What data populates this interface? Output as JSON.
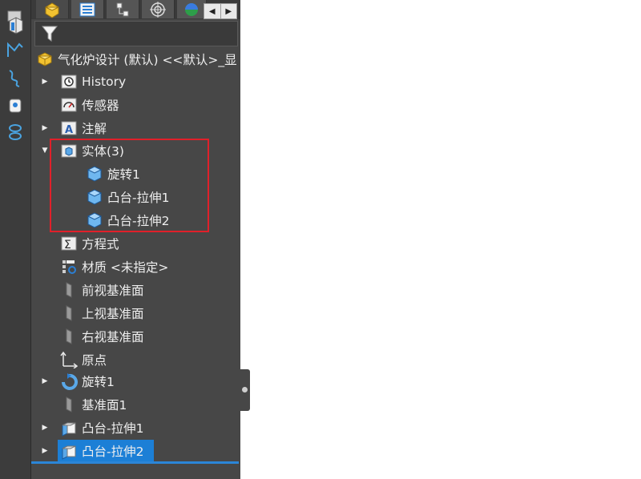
{
  "feature_tree": {
    "root_label": "气化炉设计 (默认) <<默认>_显",
    "items": [
      {
        "label": "History"
      },
      {
        "label": "传感器"
      },
      {
        "label": "注解"
      },
      {
        "label": "实体(3)"
      },
      {
        "label": "旋转1"
      },
      {
        "label": "凸台-拉伸1"
      },
      {
        "label": "凸台-拉伸2"
      },
      {
        "label": "方程式"
      },
      {
        "label": "材质 <未指定>"
      },
      {
        "label": "前视基准面"
      },
      {
        "label": "上视基准面"
      },
      {
        "label": "右视基准面"
      },
      {
        "label": "原点"
      },
      {
        "label": "旋转1"
      },
      {
        "label": "基准面1"
      },
      {
        "label": "凸台-拉伸1"
      },
      {
        "label": "凸台-拉伸2"
      }
    ]
  },
  "tabs": [
    {
      "icon": "feature-manager-icon"
    },
    {
      "icon": "property-manager-icon"
    },
    {
      "icon": "configuration-manager-icon"
    },
    {
      "icon": "dimxpert-icon"
    },
    {
      "icon": "display-manager-icon"
    }
  ],
  "colors": {
    "panel_bg": "#474747",
    "text": "#eeeeee",
    "selection": "#1c7fd6",
    "highlight_box": "#e0202a"
  }
}
